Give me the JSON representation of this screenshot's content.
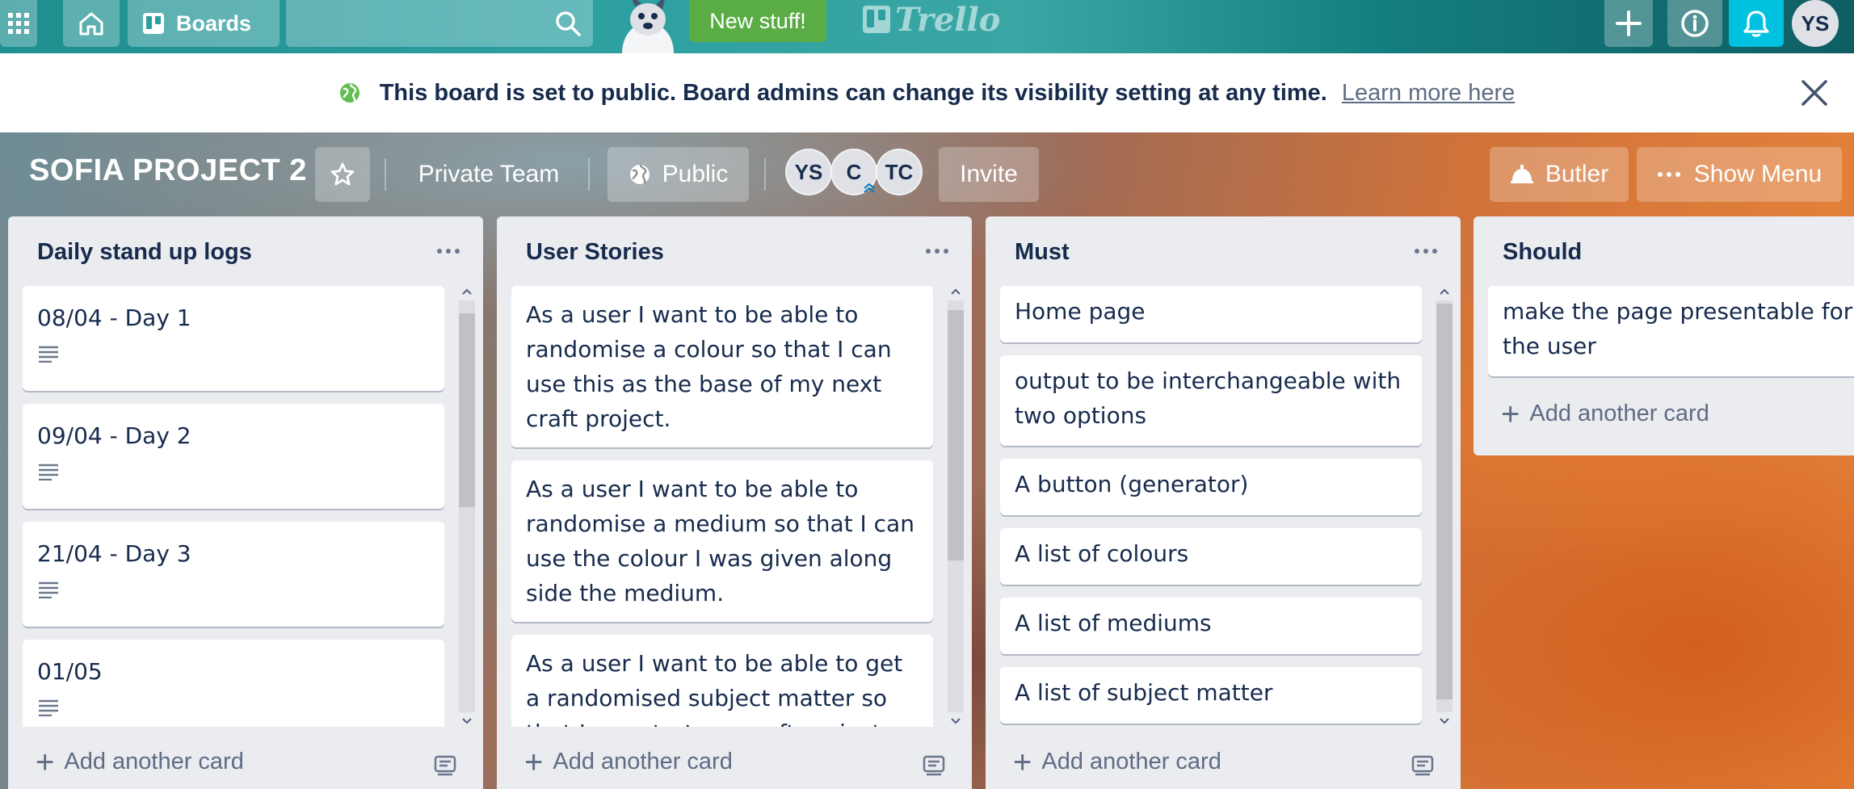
{
  "header": {
    "boards_label": "Boards",
    "new_stuff_label": "New stuff!",
    "logo_text": "Trello",
    "user_initials": "YS"
  },
  "banner": {
    "message": "This board is set to public. Board admins can change its visibility setting at any time.",
    "link_text": "Learn more here"
  },
  "board": {
    "title": "SOFIA PROJECT 2",
    "team_label": "Private Team",
    "visibility_label": "Public",
    "members": [
      "YS",
      "C",
      "TC"
    ],
    "invite_label": "Invite",
    "butler_label": "Butler",
    "show_menu_label": "Show Menu"
  },
  "lists": [
    {
      "title": "Daily stand up logs",
      "cards": [
        {
          "text": "08/04 - Day 1",
          "has_description": true
        },
        {
          "text": "09/04 - Day 2",
          "has_description": true
        },
        {
          "text": "21/04 - Day 3",
          "has_description": true
        },
        {
          "text": "01/05",
          "has_description": true
        }
      ],
      "add_label": "Add another card"
    },
    {
      "title": "User Stories",
      "cards": [
        {
          "text": "As a user I want to be able to randomise a colour so that I can use this as the base of my next craft project."
        },
        {
          "text": "As a user I want to be able to randomise a medium so that I can use the colour I was given along side the medium."
        },
        {
          "text": "As a user I want to be able to get a randomised subject matter so that I can start my craft project."
        }
      ],
      "add_label": "Add another card"
    },
    {
      "title": "Must",
      "cards": [
        {
          "text": "Home page"
        },
        {
          "text": "output to be interchangeable with two options"
        },
        {
          "text": "A button (generator)"
        },
        {
          "text": "A list of colours"
        },
        {
          "text": "A list of mediums"
        },
        {
          "text": "A list of subject matter"
        }
      ],
      "add_label": "Add another card"
    },
    {
      "title": "Should",
      "cards": [
        {
          "text": "make the page presentable for the user"
        }
      ],
      "add_label": "Add another card"
    }
  ],
  "colors": {
    "header_teal": "#2c9fa0",
    "new_stuff_green": "#5aac44",
    "notification_blue": "#00c2e0",
    "list_bg": "#ebecf0",
    "text_dark": "#172b4d",
    "text_muted": "#5e6c84"
  }
}
